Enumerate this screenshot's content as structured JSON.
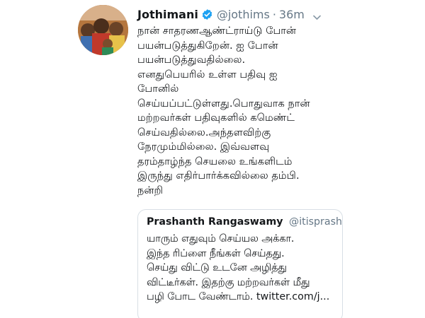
{
  "tweet": {
    "author_name": "Jothimani",
    "handle": "@jothims",
    "separator": "·",
    "time": "36m",
    "lines": [
      "நான் சாதரணஆண்ட்ராய்டு போன்",
      "பயன்படுத்துகிறேன். ஐ போன்",
      "பயன்படுத்துவதில்லை.",
      "எனதுபெயரில் உள்ள பதிவு ஐ",
      "போனில்",
      "செய்யப்பட்டுள்ளது.பொதுவாக நான்",
      "மற்றவர்கள் பதிவுகளில் கமெண்ட்",
      "செய்வதில்லை.அந்தளவிற்கு",
      "நேரமும்மில்லை. இவ்வளவு",
      "தரம்தாழ்ந்த செயலை உங்களிடம்",
      "இருந்து எதிர்பார்க்கவில்லை தம்பி.",
      "நன்றி"
    ]
  },
  "quoted_tweet": {
    "author_name": "Prashanth Rangaswamy",
    "handle": "@itisprash...",
    "lines": [
      "யாரும் எதுவும் செய்யல அக்கா.",
      "இந்த ரிப்ளை நீங்கள் செய்தது.",
      "செய்து விட்டு உடனே அழித்து",
      "விட்டீர்கள். இதற்கு மற்றவர்கள் மீது",
      "பழி போட வேண்டாம். twitter.com/j..."
    ]
  },
  "icons": {
    "verified": "verified-badge-icon",
    "caret": "chevron-down-icon"
  },
  "colors": {
    "verified": "#1da1f2",
    "secondary_text": "#657786",
    "primary_text": "#14171a",
    "border": "#d8dfe5"
  }
}
